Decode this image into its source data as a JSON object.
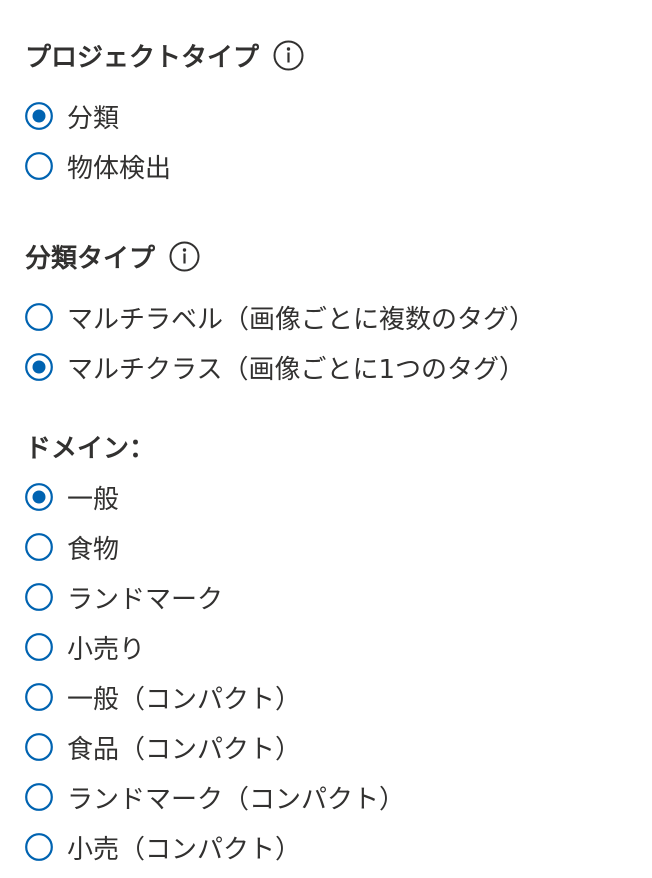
{
  "project_type": {
    "heading": "プロジェクトタイプ",
    "info_icon": "info-circle-icon",
    "options": [
      {
        "label": "分類",
        "checked": true
      },
      {
        "label": "物体検出",
        "checked": false
      }
    ]
  },
  "classification_type": {
    "heading": "分類タイプ",
    "info_icon": "info-circle-icon",
    "options": [
      {
        "label": "マルチラベル（画像ごとに複数のタグ）",
        "checked": false
      },
      {
        "label": "マルチクラス（画像ごとに1つのタグ）",
        "checked": true
      }
    ]
  },
  "domain": {
    "heading": "ドメイン：",
    "options": [
      {
        "label": "一般",
        "checked": true
      },
      {
        "label": "食物",
        "checked": false
      },
      {
        "label": "ランドマーク",
        "checked": false
      },
      {
        "label": "小売り",
        "checked": false
      },
      {
        "label": "一般（コンパクト）",
        "checked": false
      },
      {
        "label": "食品（コンパクト）",
        "checked": false
      },
      {
        "label": "ランドマーク（コンパクト）",
        "checked": false
      },
      {
        "label": "小売（コンパクト）",
        "checked": false
      }
    ]
  },
  "colors": {
    "accent": "#0063b1",
    "text": "#323130"
  }
}
